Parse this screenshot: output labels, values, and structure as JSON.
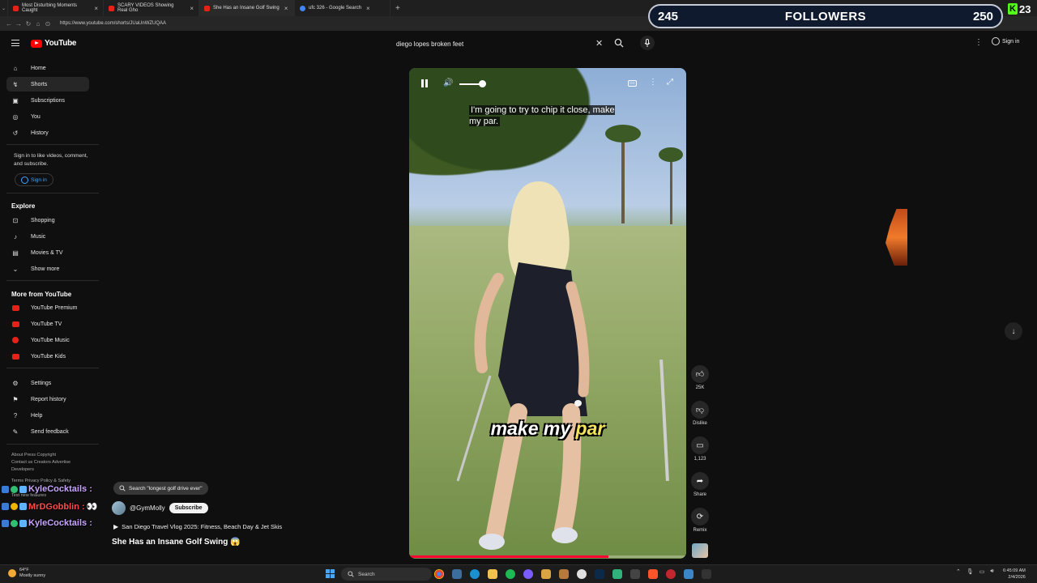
{
  "browser": {
    "tabs": [
      {
        "title": "Most Disturbing Moments Caught",
        "icon": "youtube-icon"
      },
      {
        "title": "SCARY VIDEOS Showing Real Gho",
        "icon": "youtube-icon"
      },
      {
        "title": "She Has an Insane Golf Swing",
        "icon": "youtube-icon"
      },
      {
        "title": "ufc 326 - Google Search",
        "icon": "google-icon"
      }
    ],
    "url": "https://www.youtube.com/shorts/JUaUnWZUQAA"
  },
  "stream_overlay": {
    "followers_current": "245",
    "followers_label": "FOLLOWERS",
    "followers_goal": "250",
    "kick_count": "23",
    "kick_logo": "K"
  },
  "header": {
    "logo_text": "YouTube",
    "search_value": "diego lopes broken feet",
    "signin_label": "Sign in"
  },
  "sidebar": {
    "main_items": [
      {
        "label": "Home",
        "icon": "home-icon"
      },
      {
        "label": "Shorts",
        "icon": "shorts-icon"
      },
      {
        "label": "Subscriptions",
        "icon": "subscriptions-icon"
      },
      {
        "label": "You",
        "icon": "you-icon"
      },
      {
        "label": "History",
        "icon": "history-icon"
      }
    ],
    "signin_note": "Sign in to like videos, comment, and subscribe.",
    "signin_button": "Sign in",
    "explore_heading": "Explore",
    "explore_items": [
      {
        "label": "Shopping",
        "icon": "shopping-icon"
      },
      {
        "label": "Music",
        "icon": "music-icon"
      },
      {
        "label": "Movies & TV",
        "icon": "movies-icon"
      },
      {
        "label": "Show more",
        "icon": "chevron-down-icon"
      }
    ],
    "more_heading": "More from YouTube",
    "more_items": [
      {
        "label": "YouTube Premium"
      },
      {
        "label": "YouTube TV"
      },
      {
        "label": "YouTube Music"
      },
      {
        "label": "YouTube Kids"
      }
    ],
    "settings_items": [
      {
        "label": "Settings",
        "icon": "gear-icon"
      },
      {
        "label": "Report history",
        "icon": "flag-icon"
      },
      {
        "label": "Help",
        "icon": "help-icon"
      },
      {
        "label": "Send feedback",
        "icon": "feedback-icon"
      }
    ],
    "footer_line1": "About  Press  Copyright",
    "footer_line2": "Contact us  Creators  Advertise",
    "footer_line3": "Developers",
    "footer_line4": "Terms  Privacy  Policy & Safety",
    "footer_line5": "Test new features"
  },
  "chat": [
    {
      "name": "KyleCocktails :"
    },
    {
      "name": "MrDGobblin :",
      "emote": "👀"
    },
    {
      "name": "KyleCocktails :"
    }
  ],
  "player": {
    "caption": "I'm going to try to chip it close, make my par.",
    "burned_text_a": "make my ",
    "burned_text_b": "par",
    "progress": 0.72
  },
  "actions": {
    "like_count": "25K",
    "dislike_label": "Dislike",
    "comment_count": "1,123",
    "share_label": "Share",
    "remix_label": "Remix"
  },
  "shorts_info": {
    "search_suggestion": "Search \"longest golf drive ever\"",
    "channel": "@GymMolly",
    "subscribe_label": "Subscribe",
    "related_video": "San Diego Travel Vlog 2025: Fitness, Beach Day & Jet Skis",
    "title": "She Has an Insane Golf Swing 😱"
  },
  "taskbar": {
    "temperature": "64°F",
    "weather": "Mostly sunny",
    "search_label": "Search",
    "time": "6:45:09 AM",
    "date": "2/4/2026"
  }
}
